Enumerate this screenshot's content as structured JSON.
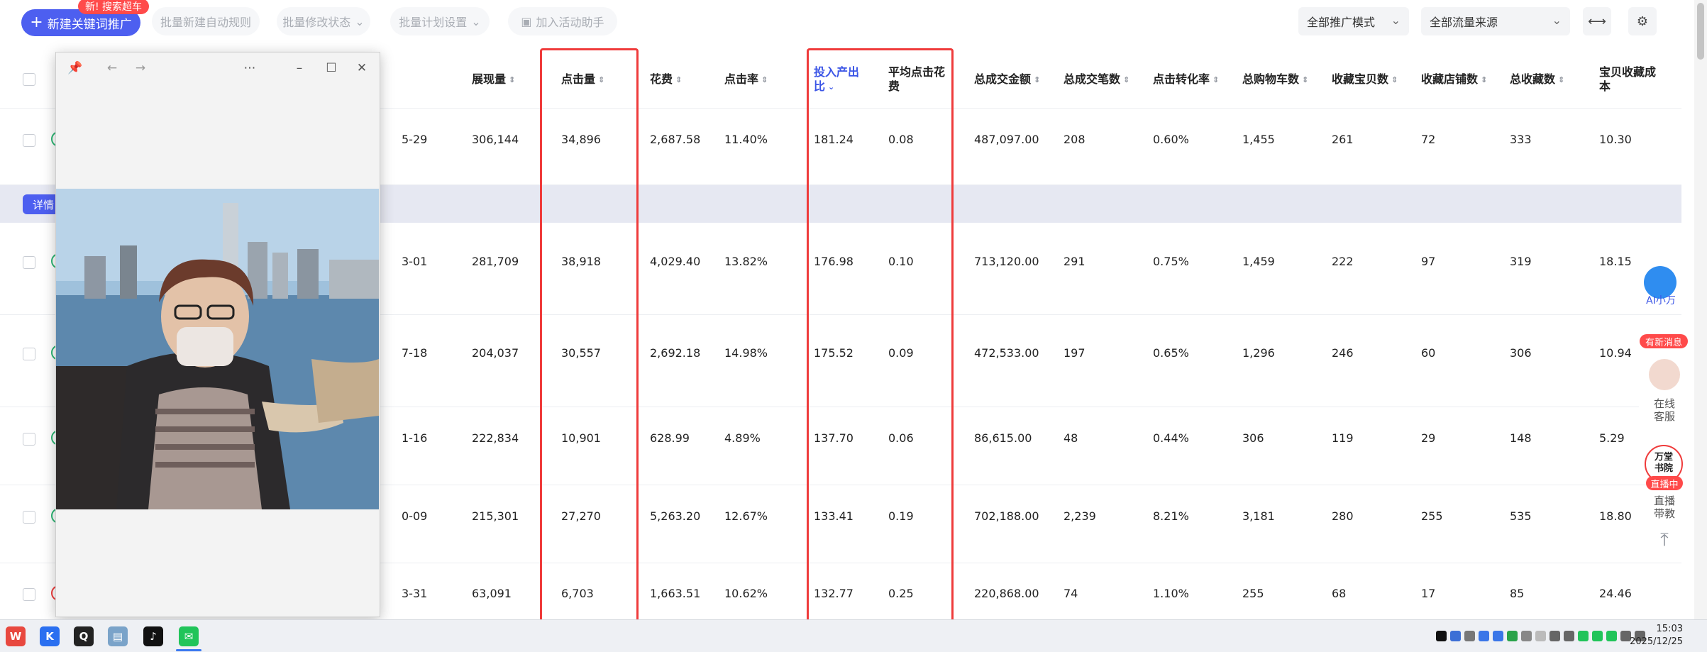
{
  "toolbar": {
    "new_keyword_btn": "新建关键词推广",
    "new_badge": "新! 搜索超车",
    "batch_rule": "批量新建自动规则",
    "batch_status": "批量修改状态",
    "batch_plan": "批量计划设置",
    "activity_helper": "加入活动助手",
    "promo_mode": "全部推广模式",
    "traffic_source": "全部流量来源"
  },
  "table": {
    "headers": [
      "展现量",
      "点击量",
      "花费",
      "点击率",
      "投入产出比",
      "平均点击花费",
      "总成交金额",
      "总成交笔数",
      "点击转化率",
      "总购物车数",
      "收藏宝贝数",
      "收藏店铺数",
      "总收藏数",
      "宝贝收藏成本"
    ],
    "header_display": {
      "roi_line1": "投入产出",
      "roi_line2": "比",
      "avg_line1": "平均点击花",
      "avg_line2": "费",
      "cost_line1": "宝贝收藏成",
      "cost_line2": "本"
    },
    "detail_label": "详情",
    "rows": [
      {
        "date": "5-29",
        "values": [
          "306,144",
          "34,896",
          "2,687.58",
          "11.40%",
          "181.24",
          "0.08",
          "487,097.00",
          "208",
          "0.60%",
          "1,455",
          "261",
          "72",
          "333",
          "10.30"
        ]
      },
      {
        "date": "3-01",
        "values": [
          "281,709",
          "38,918",
          "4,029.40",
          "13.82%",
          "176.98",
          "0.10",
          "713,120.00",
          "291",
          "0.75%",
          "1,459",
          "222",
          "97",
          "319",
          "18.15"
        ]
      },
      {
        "date": "7-18",
        "values": [
          "204,037",
          "30,557",
          "2,692.18",
          "14.98%",
          "175.52",
          "0.09",
          "472,533.00",
          "197",
          "0.65%",
          "1,296",
          "246",
          "60",
          "306",
          "10.94"
        ]
      },
      {
        "date": "1-16",
        "values": [
          "222,834",
          "10,901",
          "628.99",
          "4.89%",
          "137.70",
          "0.06",
          "86,615.00",
          "48",
          "0.44%",
          "306",
          "119",
          "29",
          "148",
          "5.29"
        ]
      },
      {
        "date": "0-09",
        "values": [
          "215,301",
          "27,270",
          "5,263.20",
          "12.67%",
          "133.41",
          "0.19",
          "702,188.00",
          "2,239",
          "8.21%",
          "3,181",
          "280",
          "255",
          "535",
          "18.80"
        ]
      },
      {
        "date": "3-31",
        "values": [
          "63,091",
          "6,703",
          "1,663.51",
          "10.62%",
          "132.77",
          "0.25",
          "220,868.00",
          "74",
          "1.10%",
          "255",
          "68",
          "17",
          "85",
          "24.46"
        ]
      }
    ]
  },
  "side": {
    "ai_label": "AI小万",
    "new_msg": "有新消息",
    "online_service_1": "在线",
    "online_service_2": "客服",
    "academy_1": "万堂",
    "academy_2": "书院",
    "live_badge": "直播中",
    "live_1": "直播",
    "live_2": "带教",
    "to_top": "⤒"
  },
  "taskbar": {
    "time": "15:03",
    "date": "2025/12/25"
  },
  "colors": {
    "primary": "#4d5ff0",
    "highlight": "#ef3b3b",
    "badge": "#ff4a4a"
  }
}
